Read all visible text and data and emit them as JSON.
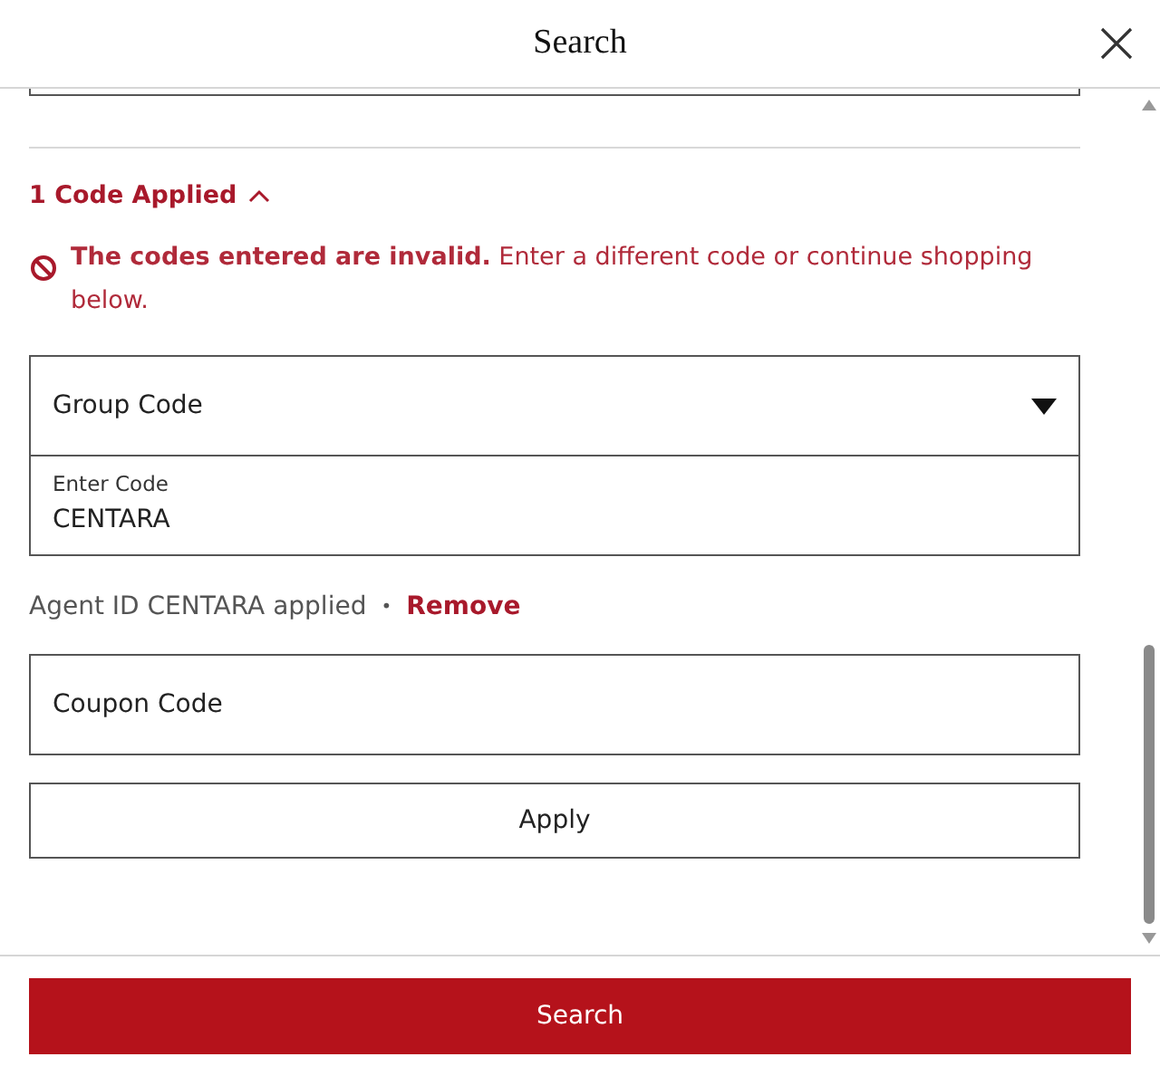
{
  "dialog": {
    "title": "Search"
  },
  "codes_toggle": {
    "label": "1 Code Applied",
    "expanded": true
  },
  "error": {
    "message": "**The codes entered are invalid.**  Enter a different code or continue shopping below."
  },
  "code_type_select": {
    "value": "Group Code"
  },
  "code_field": {
    "label": "Enter Code",
    "value": "CENTARA"
  },
  "applied_note": {
    "text": "Agent ID CENTARA applied",
    "separator": "•",
    "remove_link": "Remove"
  },
  "coupon_field": {
    "placeholder": "Coupon Code"
  },
  "apply_button": {
    "label": "Apply"
  },
  "search_button": {
    "label": "Search"
  }
}
